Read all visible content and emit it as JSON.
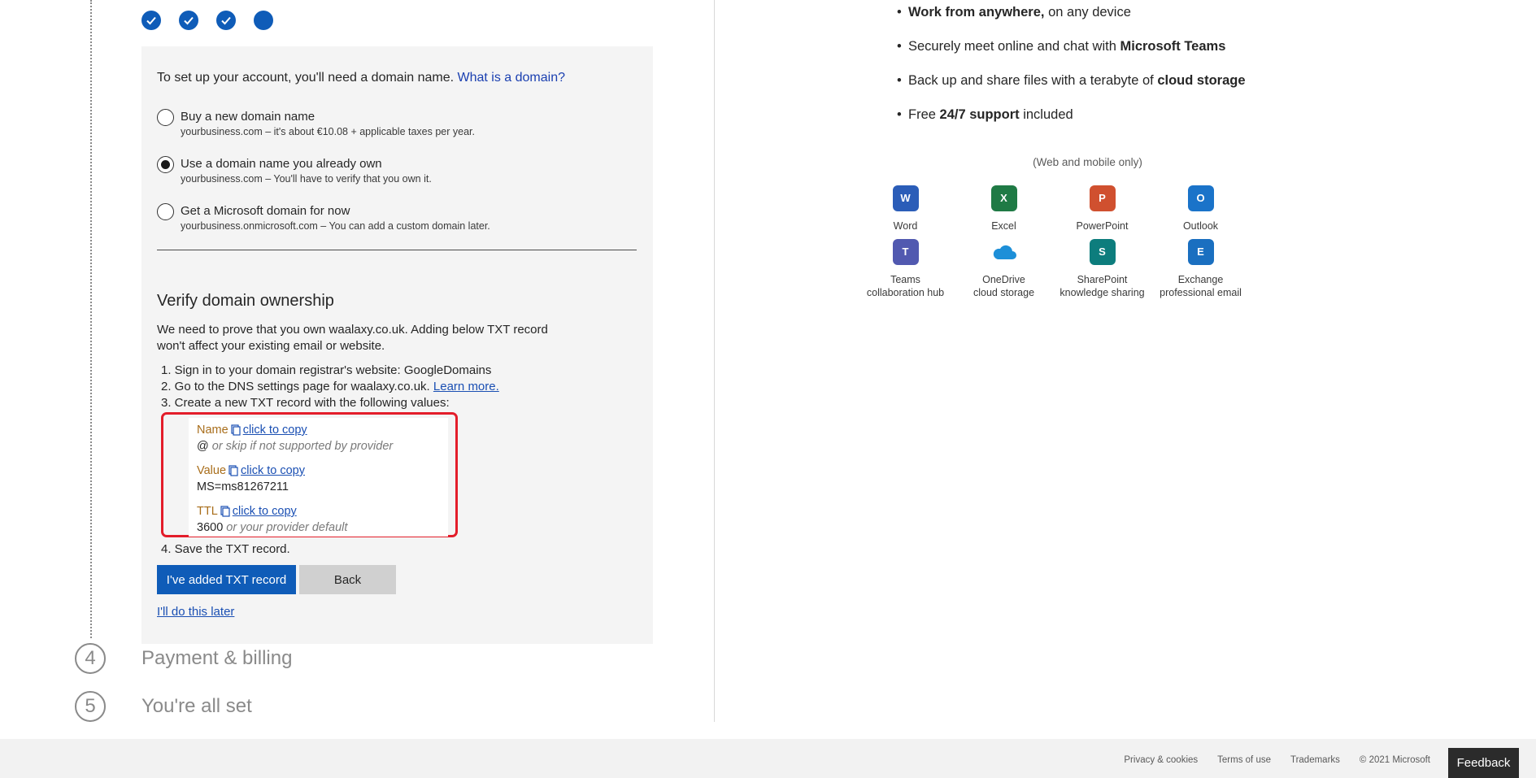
{
  "wizard": {
    "intro_text": "To set up your account, you'll need a domain name. ",
    "intro_link": "What is a domain?",
    "options": [
      {
        "title": "Buy a new domain name",
        "subtitle": "yourbusiness.com – it's about €10.08 + applicable taxes per year.",
        "selected": false
      },
      {
        "title": "Use a domain name you already own",
        "subtitle": "yourbusiness.com – You'll have to verify that you own it.",
        "selected": true
      },
      {
        "title": "Get a Microsoft domain for now",
        "subtitle": "yourbusiness.onmicrosoft.com – You can add a custom domain later.",
        "selected": false
      }
    ],
    "verify_heading": "Verify domain ownership",
    "verify_text": "We need to prove that you own waalaxy.co.uk. Adding below TXT record won't affect your existing email or website.",
    "steps": {
      "s1": "1. Sign in to your domain registrar's website: GoogleDomains",
      "s2": "2. Go to the DNS settings page for waalaxy.co.uk. ",
      "s2_link": "Learn more.",
      "s3": "3. Create a new TXT record with the following values:",
      "s4": "4. Save the TXT record."
    },
    "txt_record": {
      "name_label": "Name",
      "name_copy": "click to copy",
      "name_value": "@",
      "name_hint": "or skip if not supported by provider",
      "value_label": "Value",
      "value_copy": "click to copy",
      "value_value": "MS=ms81267211",
      "ttl_label": "TTL",
      "ttl_copy": "click to copy",
      "ttl_value": "3600",
      "ttl_hint": "or your provider default"
    },
    "primary_button": "I've added TXT record",
    "back_button": "Back",
    "later_link": "I'll do this later",
    "upcoming_steps": [
      {
        "number": "4",
        "title": "Payment & billing"
      },
      {
        "number": "5",
        "title": "You're all set"
      }
    ]
  },
  "features": {
    "bullets": [
      {
        "bold": "Work from anywhere,",
        "rest": " on any device"
      },
      {
        "pre": "Securely meet online and chat with ",
        "bold": "Microsoft Teams"
      },
      {
        "pre": "Back up and share files with a terabyte of ",
        "bold": "cloud storage"
      },
      {
        "pre": "Free ",
        "bold": "24/7 support",
        "rest": " included"
      }
    ],
    "apps_note": "(Web and mobile only)",
    "apps": [
      {
        "name": "Word",
        "icon": "word-icon",
        "color": "#2b5db8",
        "letter": "W"
      },
      {
        "name": "Excel",
        "icon": "excel-icon",
        "color": "#1f7a45",
        "letter": "X"
      },
      {
        "name": "PowerPoint",
        "icon": "powerpoint-icon",
        "color": "#d0502f",
        "letter": "P"
      },
      {
        "name": "Outlook",
        "icon": "outlook-icon",
        "color": "#1a73c9",
        "letter": "O"
      },
      {
        "name": "Teams\ncollaboration hub",
        "icon": "teams-icon",
        "color": "#5159b0",
        "letter": "T"
      },
      {
        "name": "OneDrive\ncloud storage",
        "icon": "onedrive-icon",
        "color": "#1d8fd8",
        "letter": ""
      },
      {
        "name": "SharePoint\nknowledge sharing",
        "icon": "sharepoint-icon",
        "color": "#0d7d7d",
        "letter": "S"
      },
      {
        "name": "Exchange\nprofessional email",
        "icon": "exchange-icon",
        "color": "#1a6fc0",
        "letter": "E"
      }
    ]
  },
  "footer": {
    "links": [
      "Privacy & cookies",
      "Terms of use",
      "Trademarks",
      "© 2021 Microsoft"
    ],
    "feedback": "Feedback"
  },
  "colors": {
    "accent": "#0f5cb8",
    "highlight_border": "#e31d2a"
  }
}
